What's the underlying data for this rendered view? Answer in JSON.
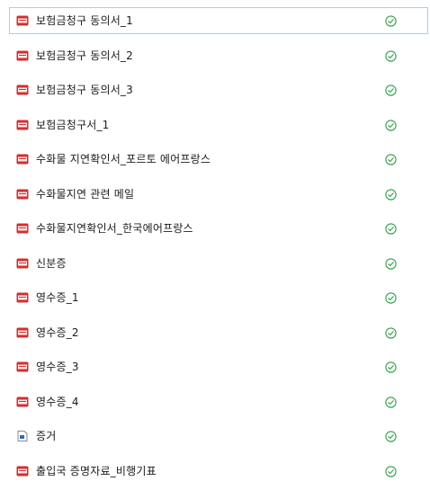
{
  "files": [
    {
      "name": "보험금청구 동의서_1",
      "type": "pdf",
      "status": "synced",
      "selected": true
    },
    {
      "name": "보험금청구 동의서_2",
      "type": "pdf",
      "status": "synced",
      "selected": false
    },
    {
      "name": "보험금청구 동의서_3",
      "type": "pdf",
      "status": "synced",
      "selected": false
    },
    {
      "name": "보험금청구서_1",
      "type": "pdf",
      "status": "synced",
      "selected": false
    },
    {
      "name": "수화물 지연확인서_포르토 에어프랑스",
      "type": "pdf",
      "status": "synced",
      "selected": false
    },
    {
      "name": "수화물지연 관련 메일",
      "type": "pdf",
      "status": "synced",
      "selected": false
    },
    {
      "name": "수화물지연확인서_한국에어프랑스",
      "type": "pdf",
      "status": "synced",
      "selected": false
    },
    {
      "name": "신분증",
      "type": "pdf",
      "status": "synced",
      "selected": false
    },
    {
      "name": "영수증_1",
      "type": "pdf",
      "status": "synced",
      "selected": false
    },
    {
      "name": "영수증_2",
      "type": "pdf",
      "status": "synced",
      "selected": false
    },
    {
      "name": "영수증_3",
      "type": "pdf",
      "status": "synced",
      "selected": false
    },
    {
      "name": "영수증_4",
      "type": "pdf",
      "status": "synced",
      "selected": false
    },
    {
      "name": "증거",
      "type": "document",
      "status": "synced",
      "selected": false
    },
    {
      "name": "출입국 증명자료_비행기표",
      "type": "pdf",
      "status": "synced",
      "selected": false
    }
  ],
  "icons": {
    "pdf": "pdf-file-icon",
    "document": "document-file-icon",
    "synced": "check-circle-icon"
  },
  "colors": {
    "pdf_red": "#d32f2f",
    "status_green": "#2e9e47",
    "selection_border": "#99d1ff",
    "document_blue": "#2f6db5"
  }
}
